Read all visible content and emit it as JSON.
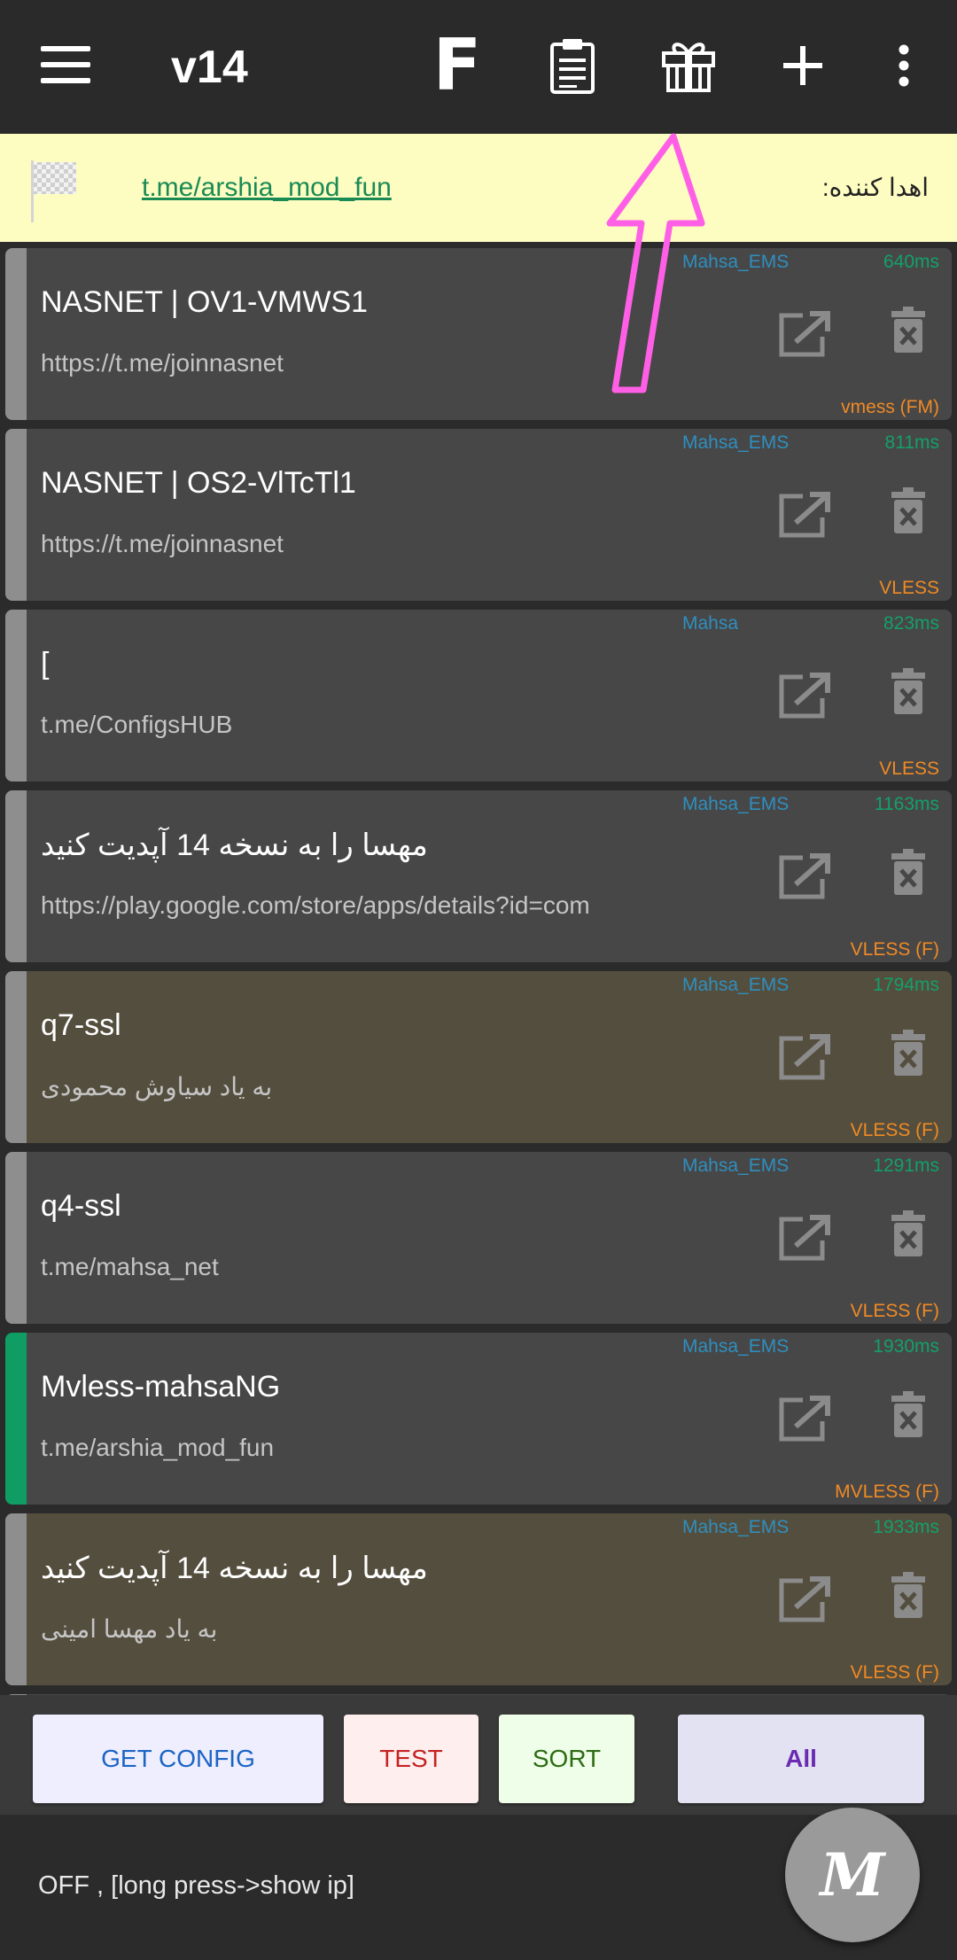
{
  "app": {
    "title": "v14"
  },
  "toolbar": {
    "f_label": "F"
  },
  "donor": {
    "link": "t.me/arshia_mod_fun",
    "label": "اهدا کننده:"
  },
  "configs": [
    {
      "name": "NASNET | OV1-VMWS1",
      "sub": "https://t.me/joinnasnet",
      "group": "Mahsa_EMS",
      "ping": "640ms",
      "protocol": "vmess (FM)",
      "style": "gray",
      "active": false
    },
    {
      "name": "NASNET | OS2-VlTcTl1",
      "sub": "https://t.me/joinnasnet",
      "group": "Mahsa_EMS",
      "ping": "811ms",
      "protocol": "VLESS",
      "style": "gray",
      "active": false
    },
    {
      "name": "[",
      "sub": "t.me/ConfigsHUB",
      "group": "Mahsa",
      "ping": "823ms",
      "protocol": "VLESS",
      "style": "gray",
      "active": false
    },
    {
      "name": "مهسا را به نسخه 14 آپدیت کنید",
      "sub": "https://play.google.com/store/apps/details?id=com",
      "group": "Mahsa_EMS",
      "ping": "1163ms",
      "protocol": "VLESS (F)",
      "style": "gray",
      "active": false
    },
    {
      "name": "q7-ssl",
      "sub": "به یاد سیاوش محمودی",
      "group": "Mahsa_EMS",
      "ping": "1794ms",
      "protocol": "VLESS (F)",
      "style": "gold",
      "active": false
    },
    {
      "name": "q4-ssl",
      "sub": "t.me/mahsa_net",
      "group": "Mahsa_EMS",
      "ping": "1291ms",
      "protocol": "VLESS (F)",
      "style": "gray",
      "active": false
    },
    {
      "name": "Mvless-mahsaNG",
      "sub": "t.me/arshia_mod_fun",
      "group": "Mahsa_EMS",
      "ping": "1930ms",
      "protocol": "MVLESS (F)",
      "style": "gray",
      "active": true
    },
    {
      "name": "مهسا را به نسخه 14 آپدیت کنید",
      "sub": "به یاد مهسا امینی",
      "group": "Mahsa_EMS",
      "ping": "1933ms",
      "protocol": "VLESS (F)",
      "style": "gold",
      "active": false
    }
  ],
  "buttons": {
    "get_config": "GET CONFIG",
    "test": "TEST",
    "sort": "SORT",
    "filter": "All"
  },
  "status": {
    "text": "OFF , [long press->show ip]"
  },
  "fab": {
    "glyph": "M"
  },
  "colors": {
    "ping": "#13a06a",
    "group": "#2f8fbf",
    "protocol": "#f08a24",
    "active_strip": "#0f9d63",
    "annotation_arrow": "#ff5fe6"
  }
}
